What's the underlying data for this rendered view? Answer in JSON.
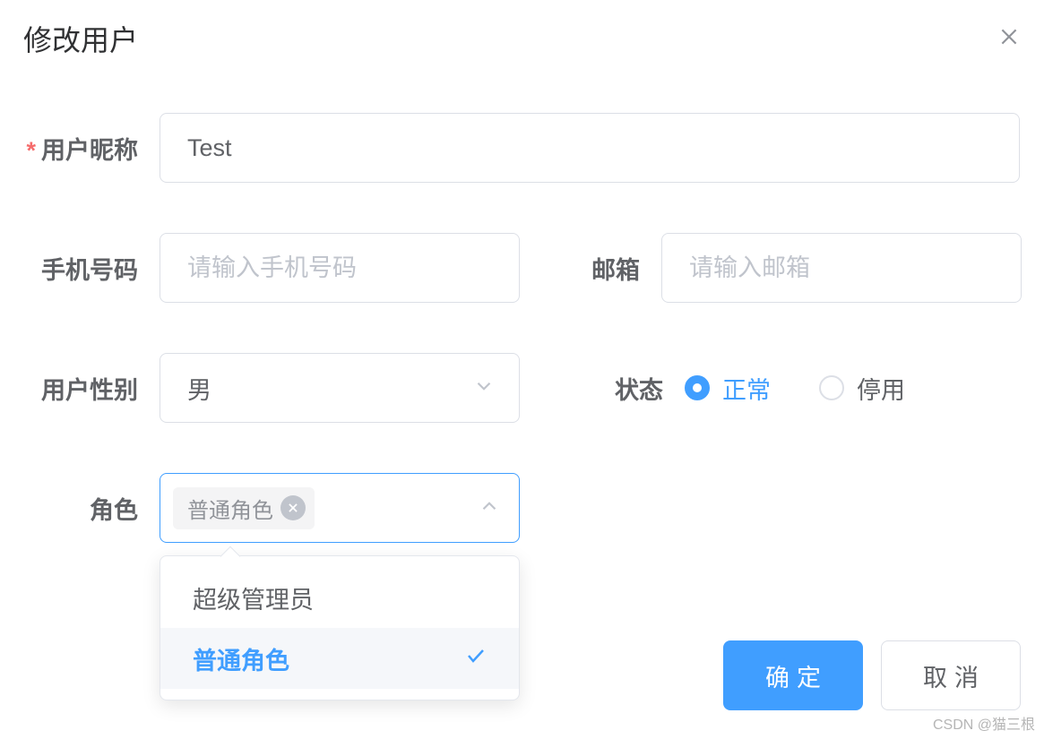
{
  "dialog": {
    "title": "修改用户"
  },
  "form": {
    "nickname": {
      "label": "用户昵称",
      "value": "Test"
    },
    "phone": {
      "label": "手机号码",
      "placeholder": "请输入手机号码",
      "value": ""
    },
    "email": {
      "label": "邮箱",
      "placeholder": "请输入邮箱",
      "value": ""
    },
    "gender": {
      "label": "用户性别",
      "selected": "男"
    },
    "status": {
      "label": "状态",
      "options": [
        "正常",
        "停用"
      ],
      "selected": "正常"
    },
    "role": {
      "label": "角色",
      "tag": "普通角色",
      "options": [
        "超级管理员",
        "普通角色"
      ],
      "selected": "普通角色"
    }
  },
  "buttons": {
    "confirm": "确定",
    "cancel": "取消"
  },
  "watermark": "CSDN @猫三根"
}
